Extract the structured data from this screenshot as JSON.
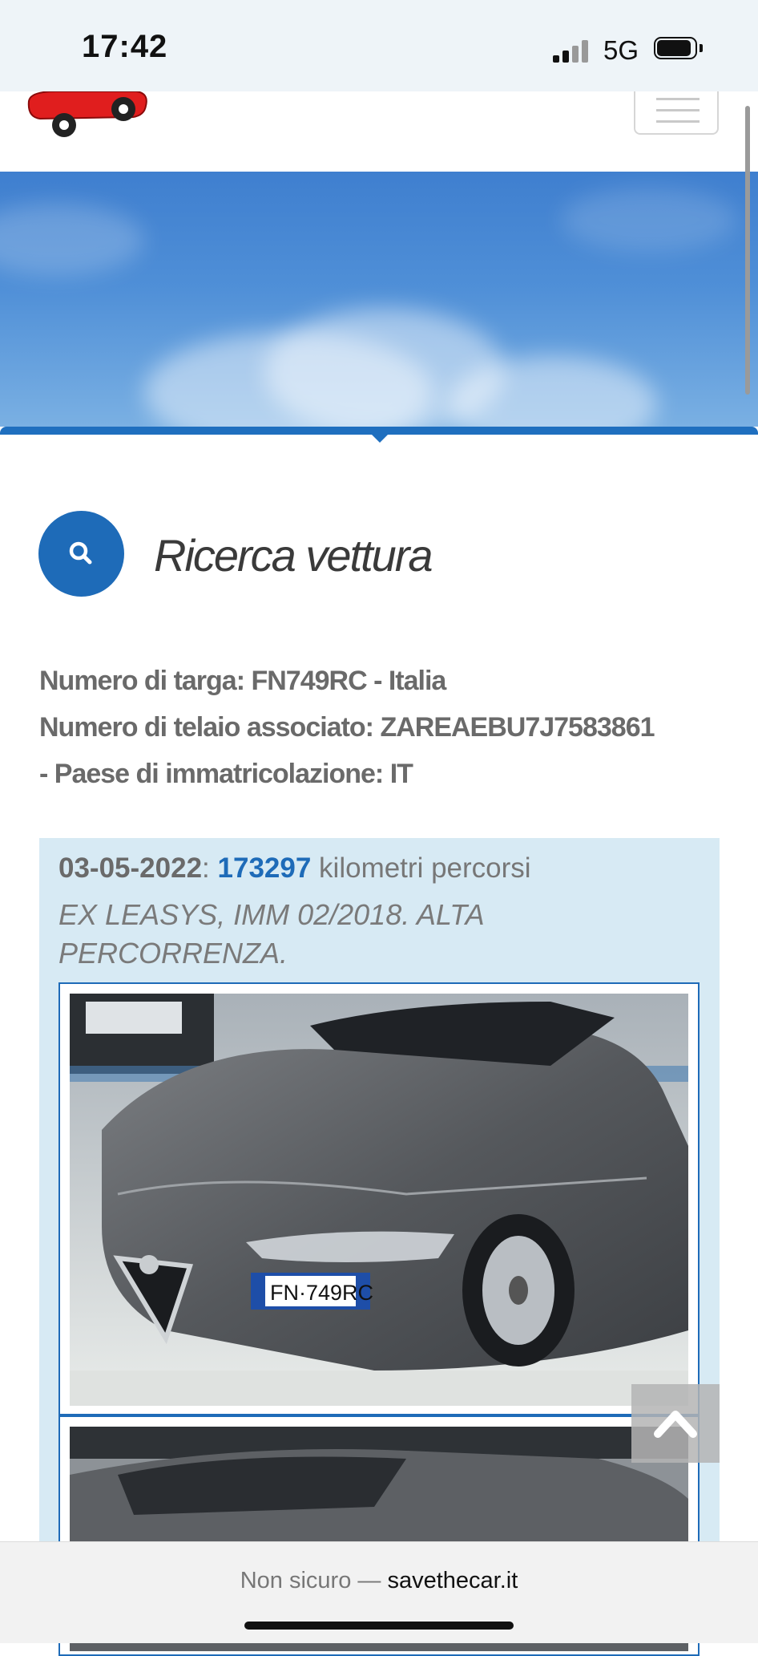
{
  "status_bar": {
    "time": "17:42",
    "network": "5G"
  },
  "heading": {
    "title": "Ricerca vettura"
  },
  "vehicle_info": {
    "line1": "Numero di targa: FN749RC - Italia",
    "line2": "Numero di telaio associato: ZAREAEBU7J7583861",
    "line3": "- Paese di immatricolazione: IT"
  },
  "record": {
    "date": "03-05-2022",
    "separator": ":",
    "km": "173297",
    "km_suffix": "kilometri percorsi",
    "note": "EX LEASYS, IMM 02/2018. ALTA PERCORRENZA.",
    "plate_text": "FN·749RC"
  },
  "browser": {
    "security": "Non sicuro —",
    "domain": "savethecar.it"
  },
  "colors": {
    "accent": "#1e6bb8",
    "record_bg": "#d7eaf4",
    "hero": "#4f8fd7"
  }
}
